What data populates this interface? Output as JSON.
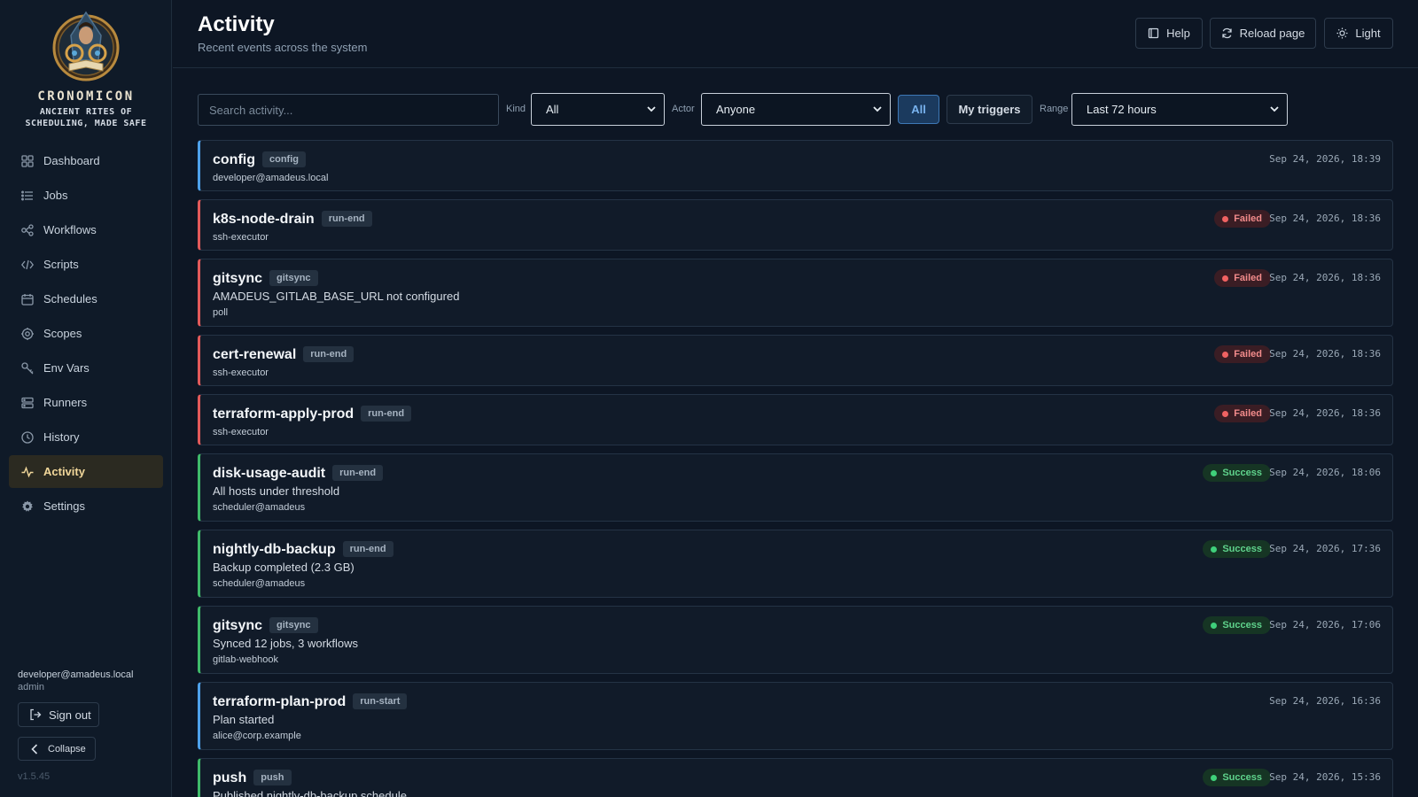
{
  "brand": {
    "name": "CRONOMICON",
    "tagline": "ANCIENT RITES OF SCHEDULING, MADE SAFE"
  },
  "sidebar": {
    "items": [
      {
        "label": "Dashboard",
        "icon": "dashboard-grid-icon",
        "active": false
      },
      {
        "label": "Jobs",
        "icon": "list-icon",
        "active": false
      },
      {
        "label": "Workflows",
        "icon": "workflow-icon",
        "active": false
      },
      {
        "label": "Scripts",
        "icon": "code-icon",
        "active": false
      },
      {
        "label": "Schedules",
        "icon": "calendar-icon",
        "active": false
      },
      {
        "label": "Scopes",
        "icon": "target-icon",
        "active": false
      },
      {
        "label": "Env Vars",
        "icon": "key-icon",
        "active": false
      },
      {
        "label": "Runners",
        "icon": "server-icon",
        "active": false
      },
      {
        "label": "History",
        "icon": "clock-icon",
        "active": false
      },
      {
        "label": "Activity",
        "icon": "activity-icon",
        "active": true
      },
      {
        "label": "Settings",
        "icon": "gear-icon",
        "active": false
      }
    ],
    "user_email": "developer@amadeus.local",
    "user_role": "admin",
    "sign_out_label": "Sign out",
    "collapse_label": "Collapse",
    "version": "v1.5.45"
  },
  "header": {
    "title": "Activity",
    "subtitle": "Recent events across the system",
    "help_label": "Help",
    "reload_label": "Reload page",
    "theme_label": "Light"
  },
  "filters": {
    "search_placeholder": "Search activity...",
    "kind_label": "Kind",
    "kind_value": "All",
    "actor_label": "Actor",
    "actor_value": "Anyone",
    "seg_all_label": "All",
    "seg_my_label": "My triggers",
    "range_label": "Range",
    "range_value": "Last 72 hours"
  },
  "events": [
    {
      "name": "config",
      "kind": "config",
      "message": "",
      "actor": "developer@amadeus.local",
      "status": "",
      "status_type": "info",
      "time": "Sep 24, 2026, 18:39"
    },
    {
      "name": "k8s-node-drain",
      "kind": "run-end",
      "message": "",
      "actor": "ssh-executor",
      "status": "Failed",
      "status_type": "failed",
      "time": "Sep 24, 2026, 18:36"
    },
    {
      "name": "gitsync",
      "kind": "gitsync",
      "message": "AMADEUS_GITLAB_BASE_URL not configured",
      "actor": "poll",
      "status": "Failed",
      "status_type": "failed",
      "time": "Sep 24, 2026, 18:36"
    },
    {
      "name": "cert-renewal",
      "kind": "run-end",
      "message": "",
      "actor": "ssh-executor",
      "status": "Failed",
      "status_type": "failed",
      "time": "Sep 24, 2026, 18:36"
    },
    {
      "name": "terraform-apply-prod",
      "kind": "run-end",
      "message": "",
      "actor": "ssh-executor",
      "status": "Failed",
      "status_type": "failed",
      "time": "Sep 24, 2026, 18:36"
    },
    {
      "name": "disk-usage-audit",
      "kind": "run-end",
      "message": "All hosts under threshold",
      "actor": "scheduler@amadeus",
      "status": "Success",
      "status_type": "success",
      "time": "Sep 24, 2026, 18:06"
    },
    {
      "name": "nightly-db-backup",
      "kind": "run-end",
      "message": "Backup completed (2.3 GB)",
      "actor": "scheduler@amadeus",
      "status": "Success",
      "status_type": "success",
      "time": "Sep 24, 2026, 17:36"
    },
    {
      "name": "gitsync",
      "kind": "gitsync",
      "message": "Synced 12 jobs, 3 workflows",
      "actor": "gitlab-webhook",
      "status": "Success",
      "status_type": "success",
      "time": "Sep 24, 2026, 17:06"
    },
    {
      "name": "terraform-plan-prod",
      "kind": "run-start",
      "message": "Plan started",
      "actor": "alice@corp.example",
      "status": "",
      "status_type": "info",
      "time": "Sep 24, 2026, 16:36"
    },
    {
      "name": "push",
      "kind": "push",
      "message": "Published nightly-db-backup schedule",
      "actor": "",
      "status": "Success",
      "status_type": "success",
      "time": "Sep 24, 2026, 15:36"
    }
  ],
  "colors": {
    "accent": "#4ea1ea",
    "failed": "#e25a5a",
    "success": "#3fba6a",
    "active_nav": "#f1d79a"
  }
}
